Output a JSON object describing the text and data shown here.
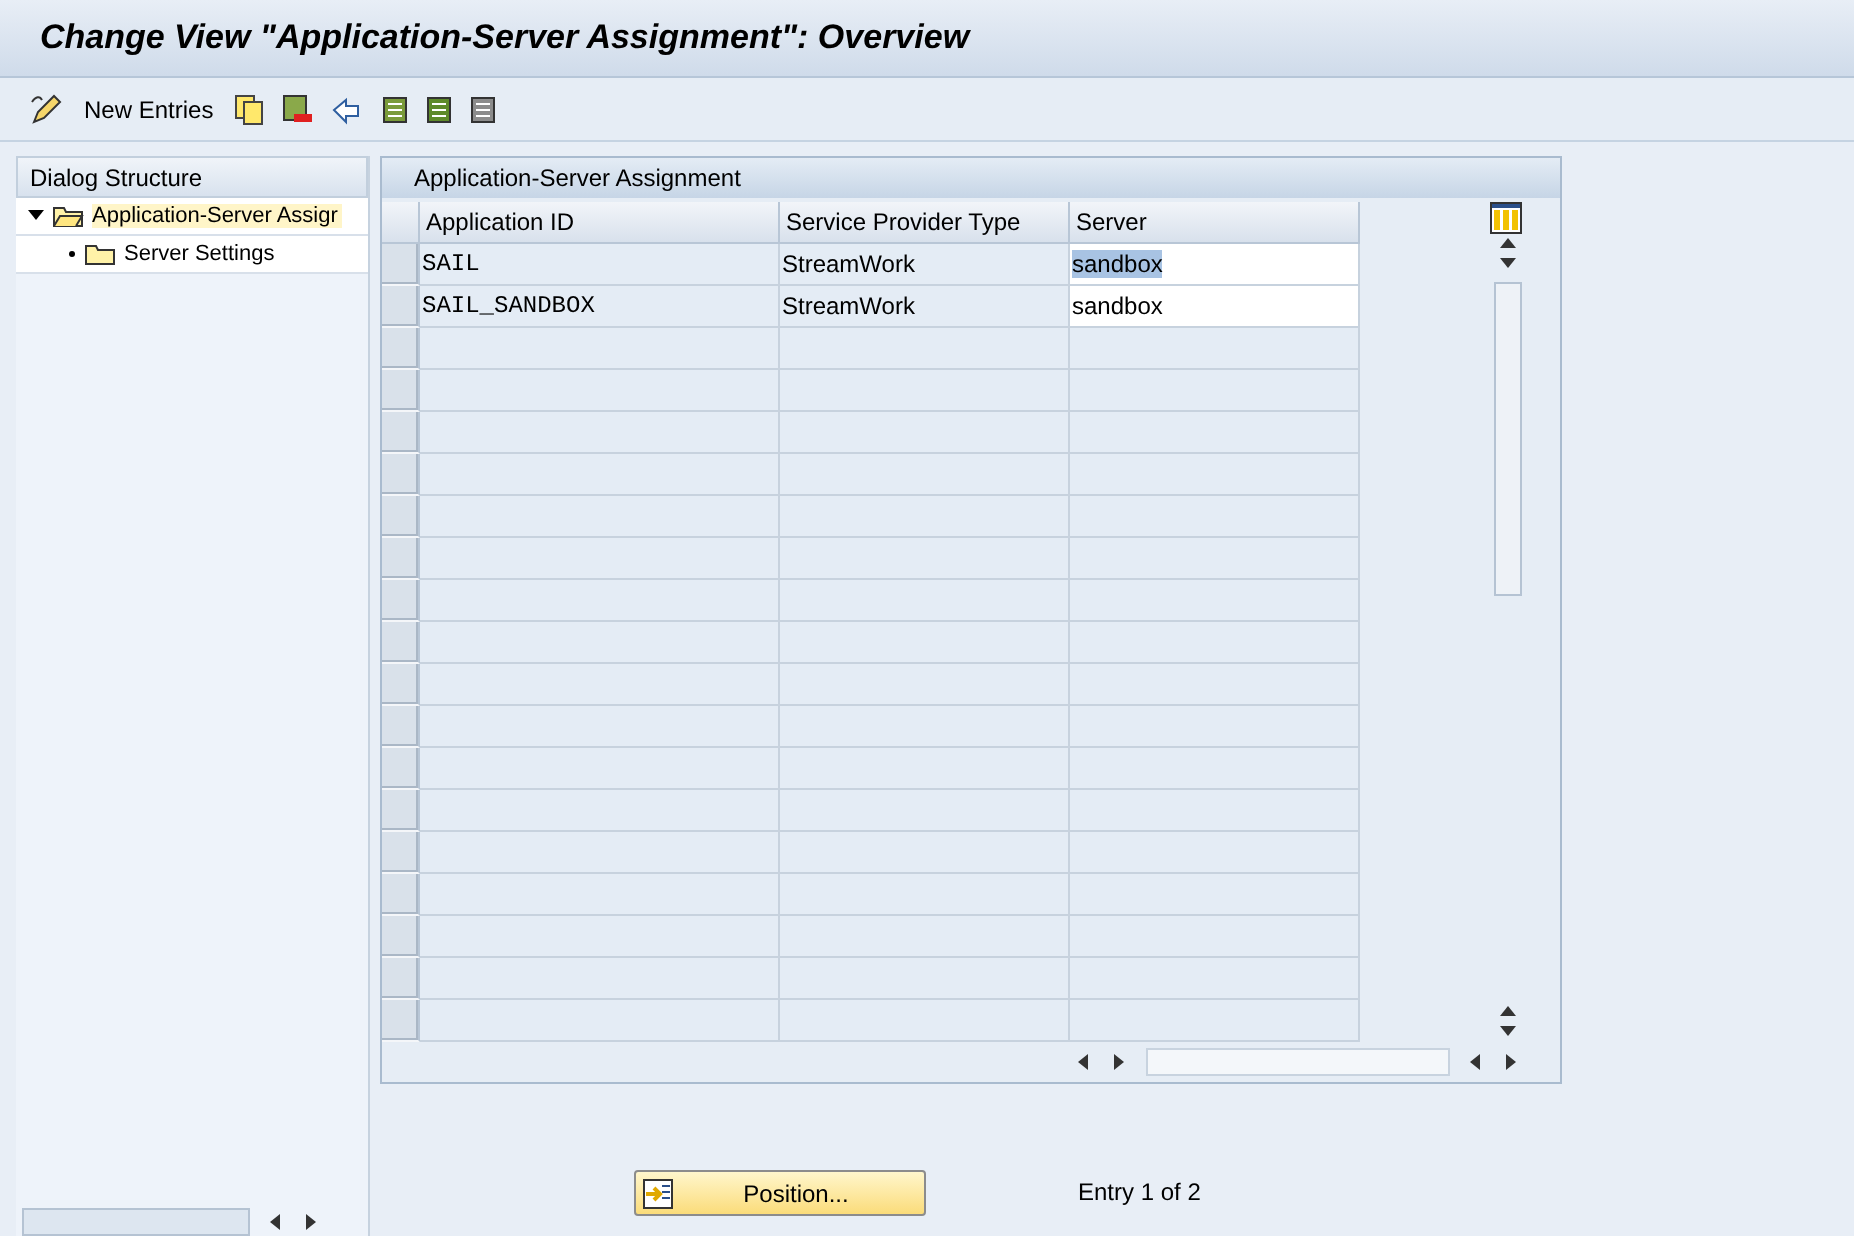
{
  "window": {
    "title": "Change View \"Application-Server Assignment\": Overview"
  },
  "toolbar": {
    "new_entries": "New Entries"
  },
  "dialog_structure": {
    "title": "Dialog Structure",
    "items": [
      {
        "label": "Application-Server Assigr",
        "selected": true,
        "expanded": true,
        "children": [
          {
            "label": "Server Settings",
            "selected": false
          }
        ]
      }
    ]
  },
  "table": {
    "title": "Application-Server Assignment",
    "columns": [
      "Application ID",
      "Service Provider Type",
      "Server"
    ],
    "rows": [
      {
        "application_id": "SAIL",
        "service_provider_type": "StreamWork",
        "server": "sandbox",
        "server_highlighted": true
      },
      {
        "application_id": "SAIL_SANDBOX",
        "service_provider_type": "StreamWork",
        "server": "sandbox",
        "server_highlighted": false
      }
    ]
  },
  "footer": {
    "position_button": "Position...",
    "entry_count": "Entry 1 of 2"
  }
}
